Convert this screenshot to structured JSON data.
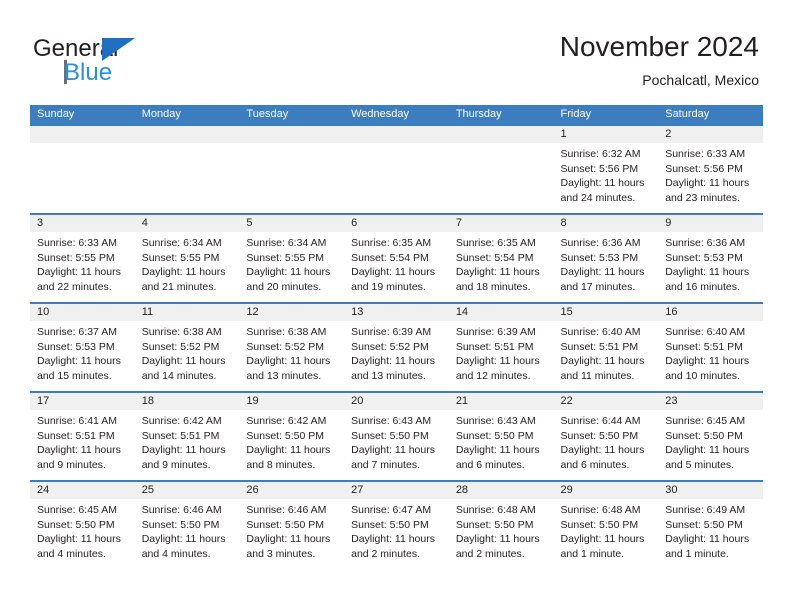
{
  "brand": {
    "name_part1": "General",
    "name_part2": "Blue",
    "flag_icon": "blue-triangle-flag-icon"
  },
  "header": {
    "title": "November 2024",
    "location": "Pochalcatl, Mexico"
  },
  "colors": {
    "header_blue": "#3b7dbf",
    "brand_blue": "#2a8fd4",
    "flag_blue": "#1f6fc0",
    "daynum_band": "#f0f0f0",
    "text": "#231f20"
  },
  "weekdays": [
    "Sunday",
    "Monday",
    "Tuesday",
    "Wednesday",
    "Thursday",
    "Friday",
    "Saturday"
  ],
  "weeks": [
    [
      {
        "day": "",
        "lines": []
      },
      {
        "day": "",
        "lines": []
      },
      {
        "day": "",
        "lines": []
      },
      {
        "day": "",
        "lines": []
      },
      {
        "day": "",
        "lines": []
      },
      {
        "day": "1",
        "lines": [
          "Sunrise: 6:32 AM",
          "Sunset: 5:56 PM",
          "Daylight: 11 hours",
          "and 24 minutes."
        ]
      },
      {
        "day": "2",
        "lines": [
          "Sunrise: 6:33 AM",
          "Sunset: 5:56 PM",
          "Daylight: 11 hours",
          "and 23 minutes."
        ]
      }
    ],
    [
      {
        "day": "3",
        "lines": [
          "Sunrise: 6:33 AM",
          "Sunset: 5:55 PM",
          "Daylight: 11 hours",
          "and 22 minutes."
        ]
      },
      {
        "day": "4",
        "lines": [
          "Sunrise: 6:34 AM",
          "Sunset: 5:55 PM",
          "Daylight: 11 hours",
          "and 21 minutes."
        ]
      },
      {
        "day": "5",
        "lines": [
          "Sunrise: 6:34 AM",
          "Sunset: 5:55 PM",
          "Daylight: 11 hours",
          "and 20 minutes."
        ]
      },
      {
        "day": "6",
        "lines": [
          "Sunrise: 6:35 AM",
          "Sunset: 5:54 PM",
          "Daylight: 11 hours",
          "and 19 minutes."
        ]
      },
      {
        "day": "7",
        "lines": [
          "Sunrise: 6:35 AM",
          "Sunset: 5:54 PM",
          "Daylight: 11 hours",
          "and 18 minutes."
        ]
      },
      {
        "day": "8",
        "lines": [
          "Sunrise: 6:36 AM",
          "Sunset: 5:53 PM",
          "Daylight: 11 hours",
          "and 17 minutes."
        ]
      },
      {
        "day": "9",
        "lines": [
          "Sunrise: 6:36 AM",
          "Sunset: 5:53 PM",
          "Daylight: 11 hours",
          "and 16 minutes."
        ]
      }
    ],
    [
      {
        "day": "10",
        "lines": [
          "Sunrise: 6:37 AM",
          "Sunset: 5:53 PM",
          "Daylight: 11 hours",
          "and 15 minutes."
        ]
      },
      {
        "day": "11",
        "lines": [
          "Sunrise: 6:38 AM",
          "Sunset: 5:52 PM",
          "Daylight: 11 hours",
          "and 14 minutes."
        ]
      },
      {
        "day": "12",
        "lines": [
          "Sunrise: 6:38 AM",
          "Sunset: 5:52 PM",
          "Daylight: 11 hours",
          "and 13 minutes."
        ]
      },
      {
        "day": "13",
        "lines": [
          "Sunrise: 6:39 AM",
          "Sunset: 5:52 PM",
          "Daylight: 11 hours",
          "and 13 minutes."
        ]
      },
      {
        "day": "14",
        "lines": [
          "Sunrise: 6:39 AM",
          "Sunset: 5:51 PM",
          "Daylight: 11 hours",
          "and 12 minutes."
        ]
      },
      {
        "day": "15",
        "lines": [
          "Sunrise: 6:40 AM",
          "Sunset: 5:51 PM",
          "Daylight: 11 hours",
          "and 11 minutes."
        ]
      },
      {
        "day": "16",
        "lines": [
          "Sunrise: 6:40 AM",
          "Sunset: 5:51 PM",
          "Daylight: 11 hours",
          "and 10 minutes."
        ]
      }
    ],
    [
      {
        "day": "17",
        "lines": [
          "Sunrise: 6:41 AM",
          "Sunset: 5:51 PM",
          "Daylight: 11 hours",
          "and 9 minutes."
        ]
      },
      {
        "day": "18",
        "lines": [
          "Sunrise: 6:42 AM",
          "Sunset: 5:51 PM",
          "Daylight: 11 hours",
          "and 9 minutes."
        ]
      },
      {
        "day": "19",
        "lines": [
          "Sunrise: 6:42 AM",
          "Sunset: 5:50 PM",
          "Daylight: 11 hours",
          "and 8 minutes."
        ]
      },
      {
        "day": "20",
        "lines": [
          "Sunrise: 6:43 AM",
          "Sunset: 5:50 PM",
          "Daylight: 11 hours",
          "and 7 minutes."
        ]
      },
      {
        "day": "21",
        "lines": [
          "Sunrise: 6:43 AM",
          "Sunset: 5:50 PM",
          "Daylight: 11 hours",
          "and 6 minutes."
        ]
      },
      {
        "day": "22",
        "lines": [
          "Sunrise: 6:44 AM",
          "Sunset: 5:50 PM",
          "Daylight: 11 hours",
          "and 6 minutes."
        ]
      },
      {
        "day": "23",
        "lines": [
          "Sunrise: 6:45 AM",
          "Sunset: 5:50 PM",
          "Daylight: 11 hours",
          "and 5 minutes."
        ]
      }
    ],
    [
      {
        "day": "24",
        "lines": [
          "Sunrise: 6:45 AM",
          "Sunset: 5:50 PM",
          "Daylight: 11 hours",
          "and 4 minutes."
        ]
      },
      {
        "day": "25",
        "lines": [
          "Sunrise: 6:46 AM",
          "Sunset: 5:50 PM",
          "Daylight: 11 hours",
          "and 4 minutes."
        ]
      },
      {
        "day": "26",
        "lines": [
          "Sunrise: 6:46 AM",
          "Sunset: 5:50 PM",
          "Daylight: 11 hours",
          "and 3 minutes."
        ]
      },
      {
        "day": "27",
        "lines": [
          "Sunrise: 6:47 AM",
          "Sunset: 5:50 PM",
          "Daylight: 11 hours",
          "and 2 minutes."
        ]
      },
      {
        "day": "28",
        "lines": [
          "Sunrise: 6:48 AM",
          "Sunset: 5:50 PM",
          "Daylight: 11 hours",
          "and 2 minutes."
        ]
      },
      {
        "day": "29",
        "lines": [
          "Sunrise: 6:48 AM",
          "Sunset: 5:50 PM",
          "Daylight: 11 hours",
          "and 1 minute."
        ]
      },
      {
        "day": "30",
        "lines": [
          "Sunrise: 6:49 AM",
          "Sunset: 5:50 PM",
          "Daylight: 11 hours",
          "and 1 minute."
        ]
      }
    ]
  ]
}
